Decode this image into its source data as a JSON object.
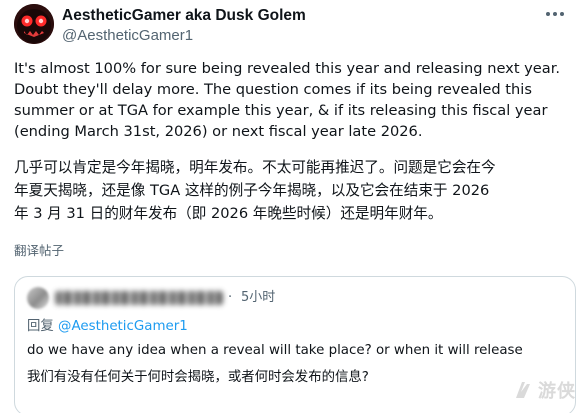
{
  "post": {
    "author": {
      "display_name": "AestheticGamer aka Dusk Golem",
      "handle": "@AestheticGamer1",
      "avatar_icon": "red-eyed-creature-avatar"
    },
    "more_icon": "more-options-icon",
    "body_en": "It's almost 100% for sure being revealed this year and releasing next year.\nDoubt they'll delay more. The question comes if its being revealed this\nsummer or at TGA for example this year, & if its releasing this fiscal year\n(ending March 31st, 2026) or next fiscal year late 2026.",
    "body_zh": "几乎可以肯定是今年揭晓，明年发布。不太可能再推迟了。问题是它会在今\n年夏天揭晓，还是像 TGA 这样的例子今年揭晓，以及它会在结束于 2026\n年 3 月 31 日的财年发布（即 2026 年晚些时候）还是明年财年。",
    "translate_label": "翻译帖子"
  },
  "quoted_post": {
    "time": "5小时",
    "separator": "·",
    "reply_prefix": "回复",
    "reply_handle": "@AestheticGamer1",
    "text_en": "do we have any idea when a reveal will take place? or when it will release",
    "text_zh": "我们有没有任何关于何时会揭晓，或者何时会发布的信息?"
  },
  "watermark": {
    "text": "游侠",
    "icon": "gamersky-logo-icon"
  },
  "colors": {
    "text_primary": "#0f1419",
    "text_secondary": "#536471",
    "link": "#1d9bf0",
    "border": "#cfd9de",
    "avatar_bg": "#2b0d0d",
    "avatar_eyes": "#ff2a2a"
  }
}
